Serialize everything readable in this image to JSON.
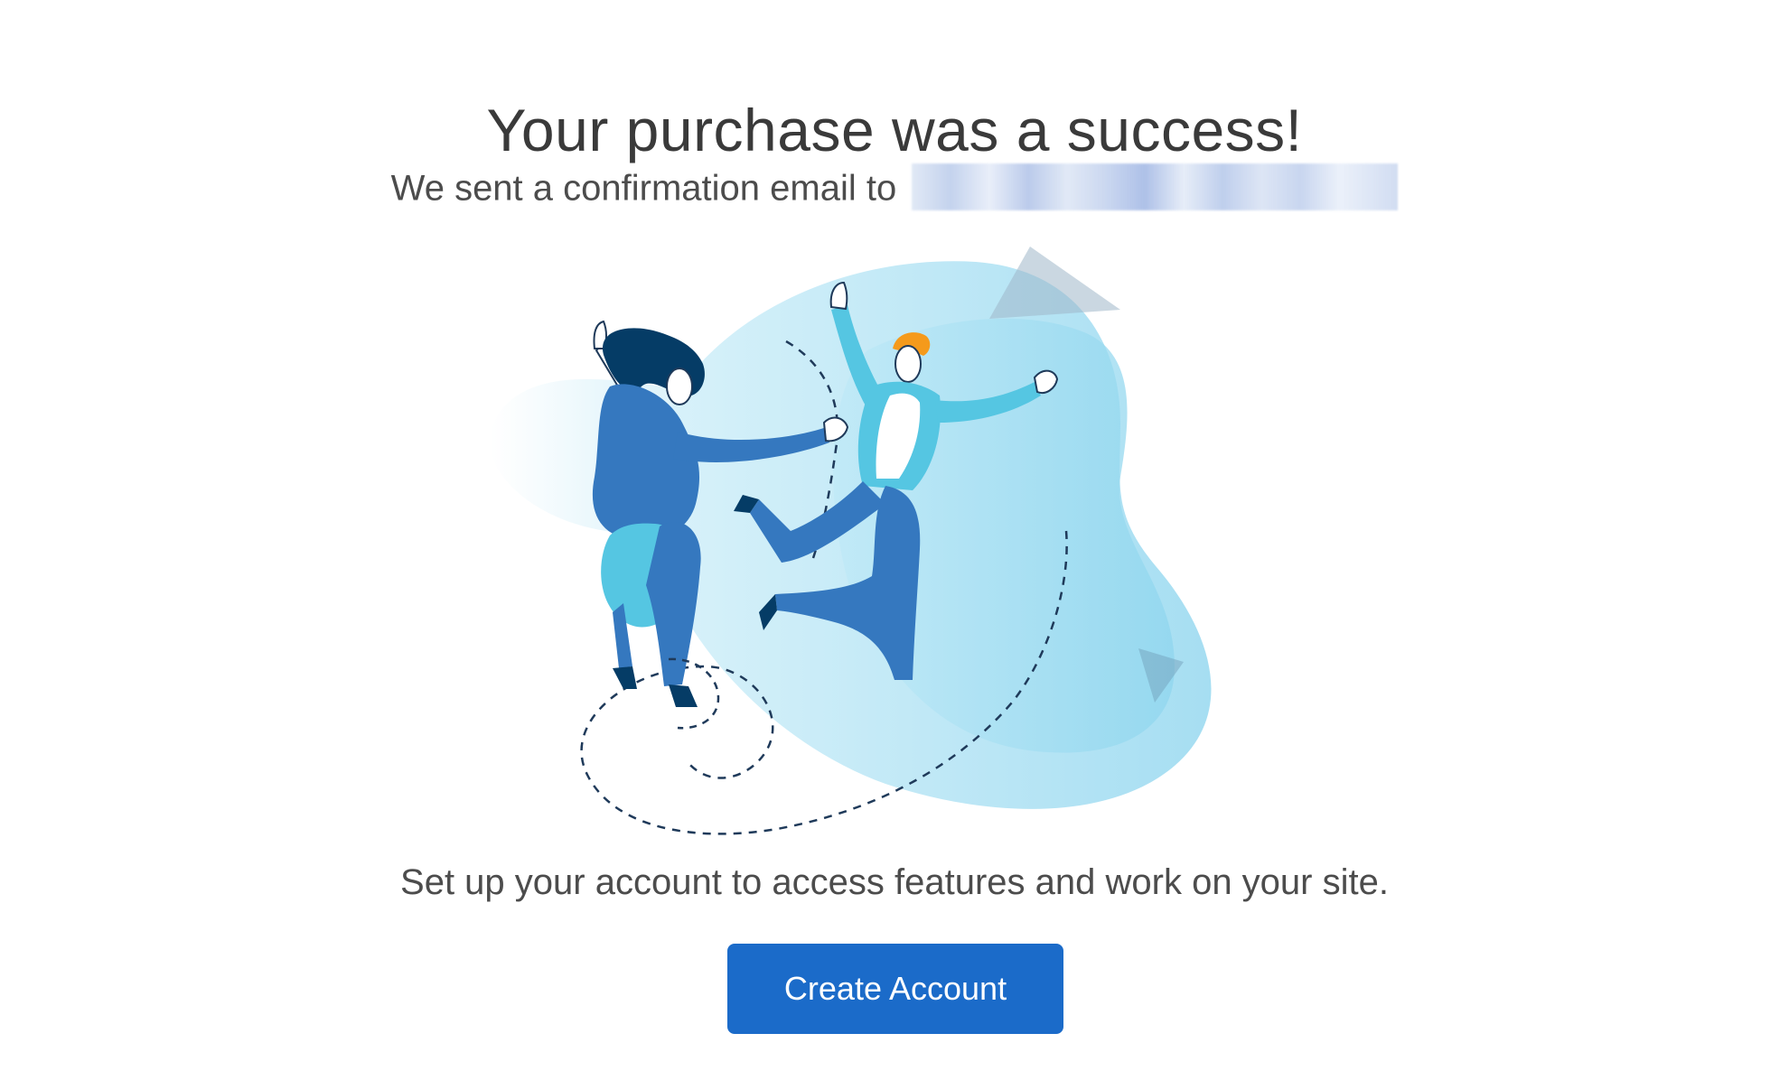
{
  "main": {
    "title": "Your purchase was a success!",
    "confirmation_text": "We sent a confirmation email to",
    "setup_text": "Set up your account to access features and work on your site.",
    "create_account_label": "Create Account"
  },
  "colors": {
    "button": "#1b6bc9",
    "heading": "#3a3a3a",
    "body_text": "#4c4c4c",
    "blob_light": "#d7f1fa",
    "blob_mid": "#9fdcf1",
    "figure_dark_blue": "#3578bf",
    "figure_light_blue": "#55c6e2",
    "hair_dark": "#053c66",
    "hair_orange": "#f59a1b"
  },
  "icons": {
    "illustration": "celebrating-people-illustration",
    "email": "blurred-email-address"
  }
}
